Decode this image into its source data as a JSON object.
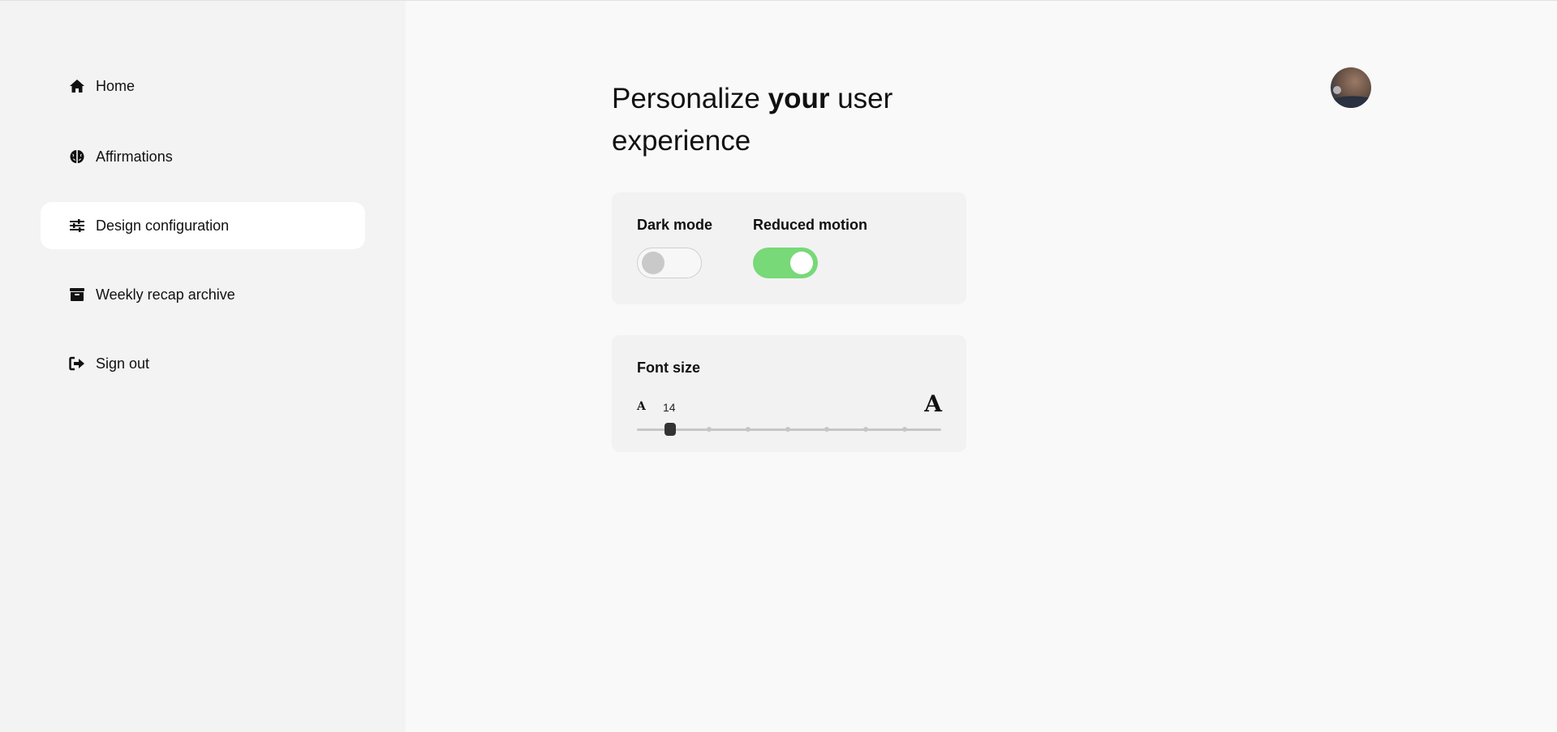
{
  "sidebar": {
    "items": [
      {
        "label": "Home",
        "icon": "home-icon",
        "active": false
      },
      {
        "label": "Affirmations",
        "icon": "brain-icon",
        "active": false
      },
      {
        "label": "Design configuration",
        "icon": "sliders-icon",
        "active": true
      },
      {
        "label": "Weekly recap archive",
        "icon": "archive-icon",
        "active": false
      },
      {
        "label": "Sign out",
        "icon": "sign-out-icon",
        "active": false
      }
    ]
  },
  "header": {
    "title_pre": "Personalize ",
    "title_bold": "your",
    "title_post": " user experience",
    "avatar_icon": "user-avatar"
  },
  "settings": {
    "dark_mode": {
      "label": "Dark mode",
      "enabled": false
    },
    "reduced_motion": {
      "label": "Reduced motion",
      "enabled": true
    },
    "font_size": {
      "label": "Font size",
      "small_glyph": "A",
      "large_glyph": "A",
      "value": "14",
      "steps": 7,
      "selected_step": 0
    }
  },
  "colors": {
    "toggle_on": "#77d977",
    "toggle_off_knob": "#c9c9c9",
    "slider_thumb": "#333333",
    "sidebar_bg": "#f3f3f3",
    "active_item_bg": "#ffffff"
  }
}
